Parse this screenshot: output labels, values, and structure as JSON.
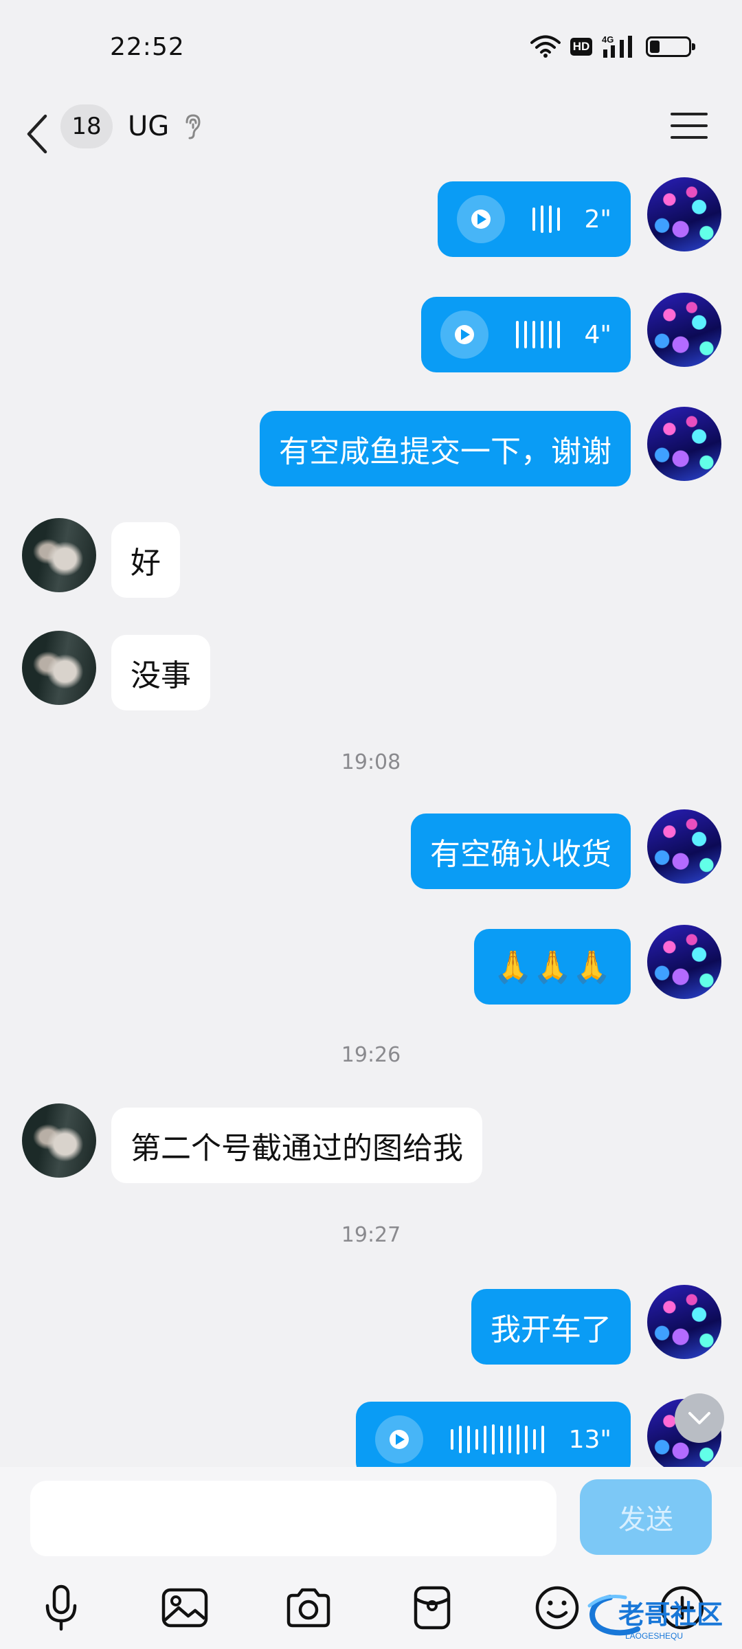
{
  "status_bar": {
    "time": "22:52",
    "hd_label": "HD",
    "network": "4G",
    "battery_level_pct": 25
  },
  "header": {
    "unread_count": "18",
    "title": "UG"
  },
  "messages": {
    "m1_duration": "2\"",
    "m2_duration": "4\"",
    "m3_text": "有空咸鱼提交一下，谢谢",
    "m4_text": "好",
    "m5_text": "没事",
    "ts1": "19:08",
    "m6_text": "有空确认收货",
    "m7_text": "🙏🙏🙏",
    "ts2": "19:26",
    "m8_text": "第二个号截通过的图给我",
    "ts3": "19:27",
    "m9_text": "我开车了",
    "m10_duration": "13\""
  },
  "input": {
    "placeholder": "",
    "send_label": "发送"
  },
  "toolbar": [
    "microphone-icon",
    "image-icon",
    "camera-icon",
    "red-packet-icon",
    "emoji-icon",
    "plus-icon"
  ],
  "watermark": {
    "text": "老哥社区",
    "subtext": "LAOGESHEQU"
  },
  "colors": {
    "outgoing_bubble": "#0a9cf5",
    "incoming_bubble": "#ffffff",
    "background": "#f1f1f3",
    "send_button": "#7cc8f6"
  }
}
